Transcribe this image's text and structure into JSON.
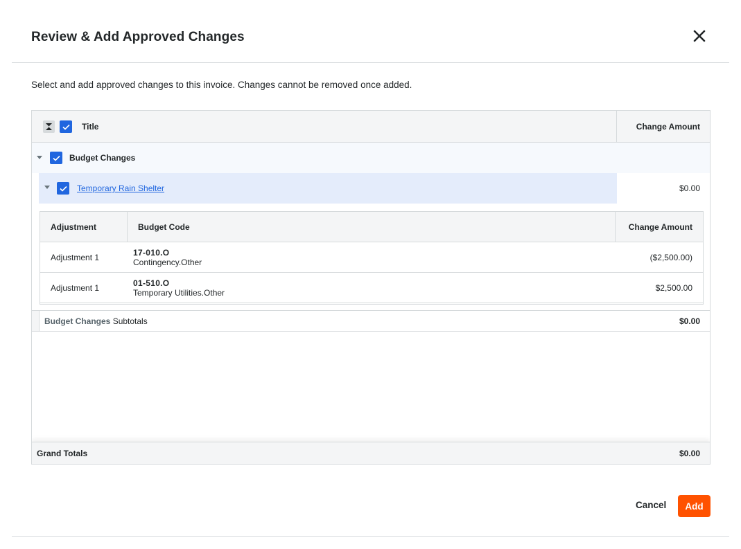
{
  "modal": {
    "title": "Review & Add Approved Changes",
    "description": "Select and add approved changes to this invoice. Changes cannot be removed once added."
  },
  "table": {
    "header": {
      "title": "Title",
      "amount": "Change Amount"
    },
    "group": {
      "label": "Budget Changes",
      "checked": true,
      "item": {
        "title": "Temporary Rain Shelter",
        "amount": "$0.00",
        "checked": true,
        "subtable": {
          "headers": {
            "adjustment": "Adjustment",
            "budget_code": "Budget Code",
            "amount": "Change Amount"
          },
          "rows": [
            {
              "adjustment": "Adjustment 1",
              "code": "17-010.O",
              "code_desc": "Contingency.Other",
              "amount": "($2,500.00)"
            },
            {
              "adjustment": "Adjustment 1",
              "code": "01-510.O",
              "code_desc": "Temporary Utilities.Other",
              "amount": "$2,500.00"
            }
          ]
        }
      },
      "subtotal_label": "Budget Changes",
      "subtotal_suffix": "Subtotals",
      "subtotal_value": "$0.00"
    },
    "grand_total": {
      "label": "Grand Totals",
      "value": "$0.00"
    }
  },
  "footer": {
    "cancel_label": "Cancel",
    "add_label": "Add"
  },
  "colors": {
    "accent": "#ff5200",
    "checkbox": "#2066df",
    "link": "#2066df"
  }
}
